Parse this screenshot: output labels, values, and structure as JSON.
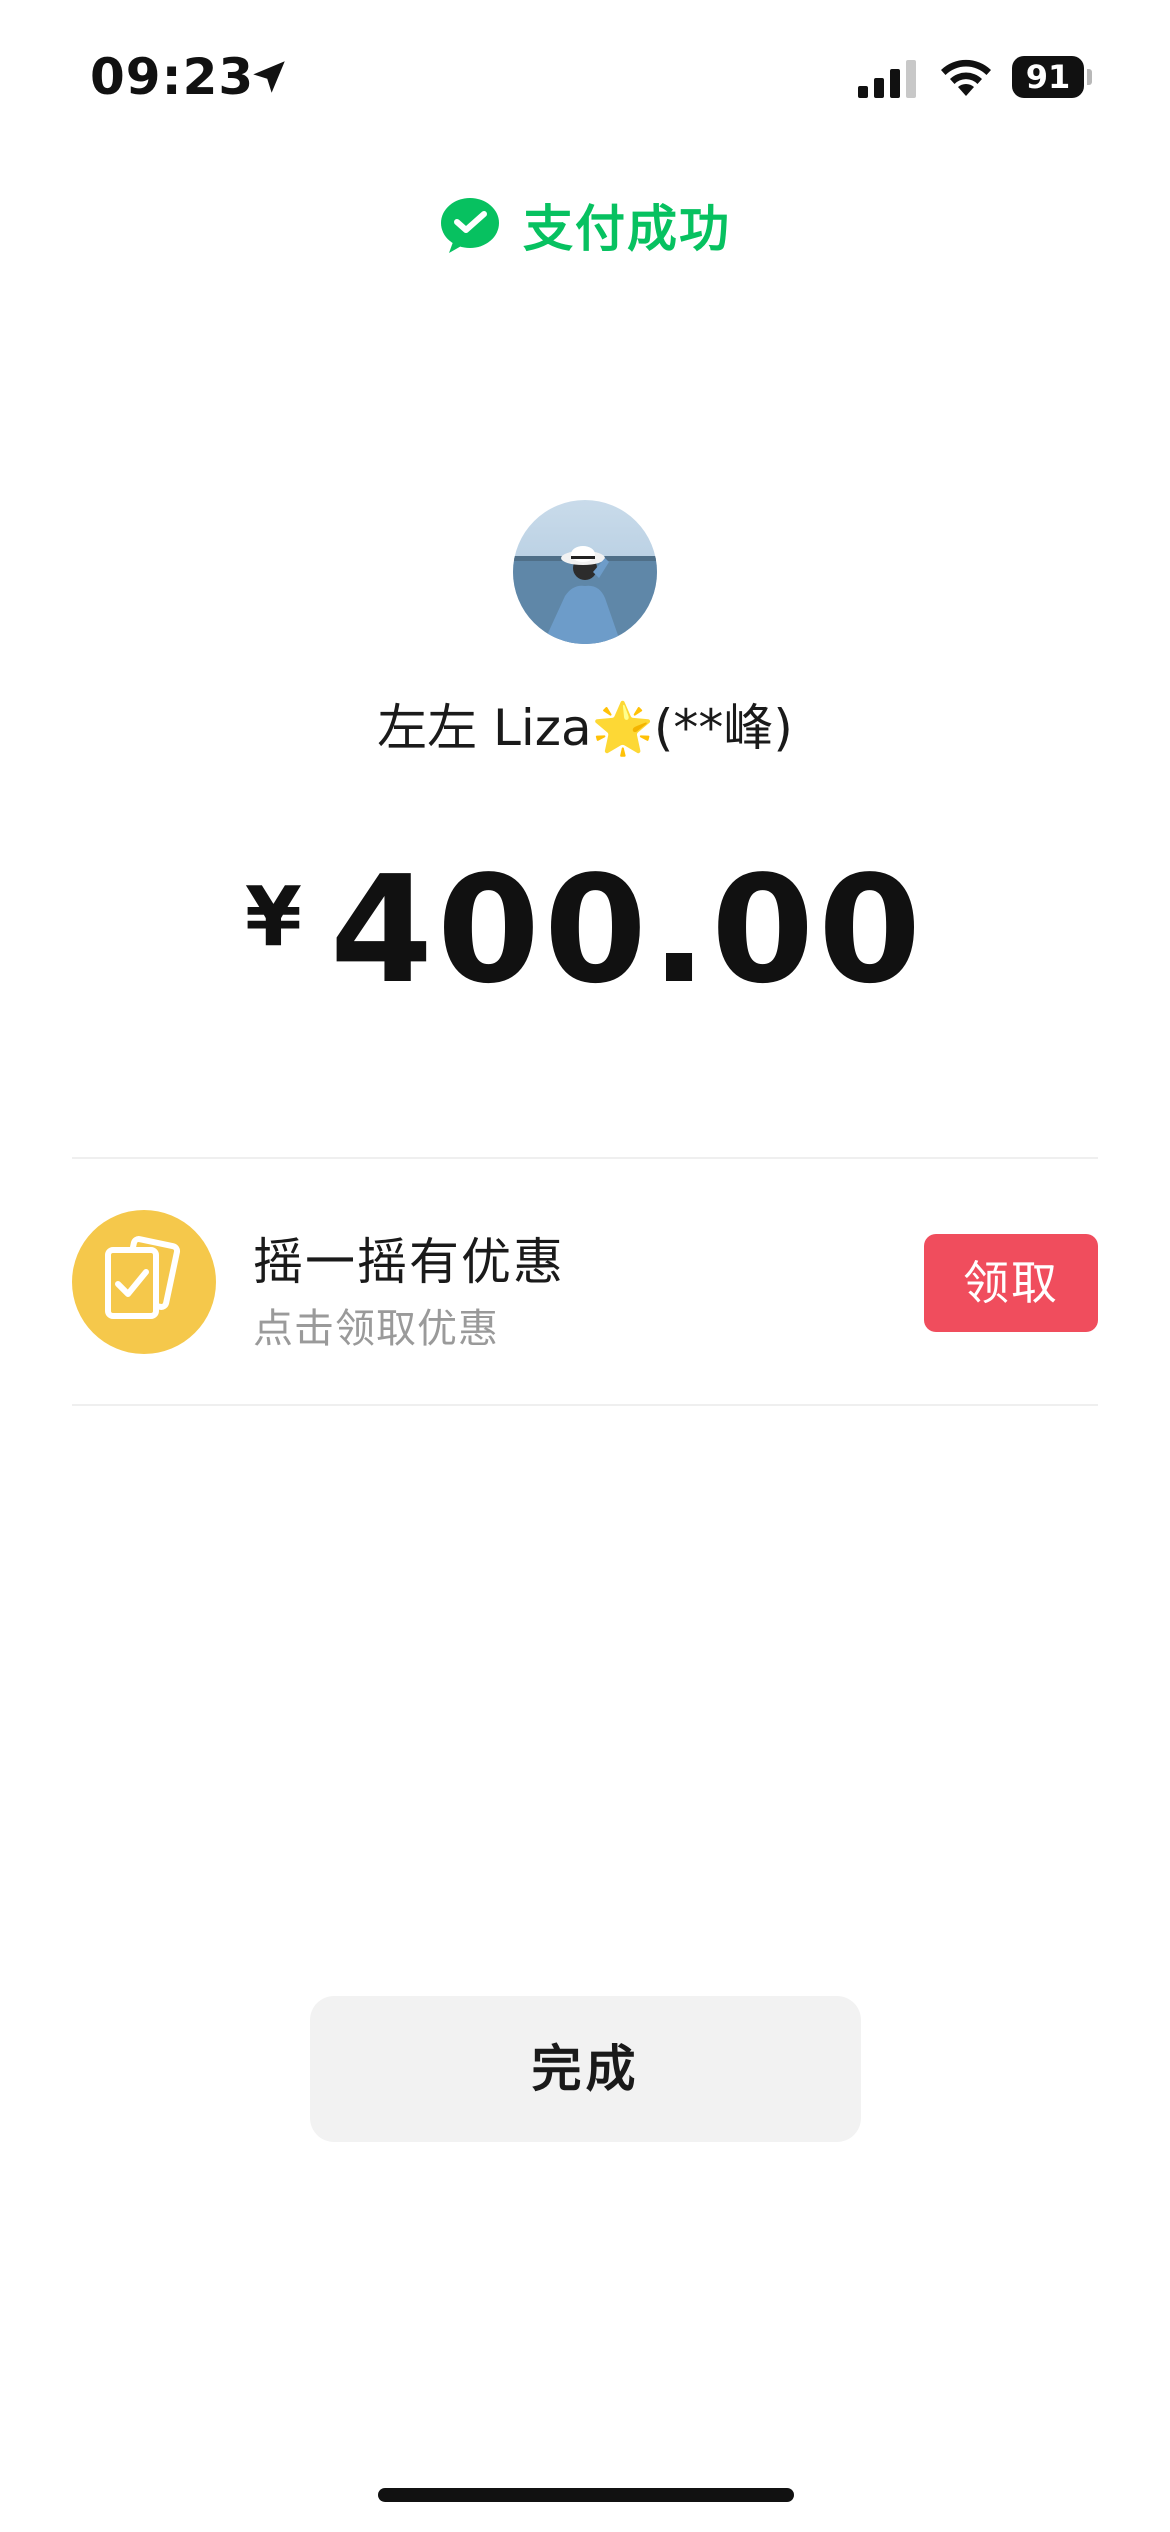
{
  "status_bar": {
    "time": "09:23",
    "battery_level": "91",
    "signal_bars_filled": 3,
    "signal_bars_total": 4,
    "location_icon": "location-arrow-icon",
    "wifi_icon": "wifi-icon"
  },
  "header": {
    "icon": "wechat-pay-icon",
    "title": "支付成功",
    "color": "#07c160"
  },
  "payee": {
    "avatar": "avatar",
    "name": "左左 Liza🌟(**峰)"
  },
  "payment": {
    "currency_symbol": "¥",
    "amount": "400.00"
  },
  "promo": {
    "icon": "coupon-cards-icon",
    "title": "摇一摇有优惠",
    "subtitle": "点击领取优惠",
    "button_label": "领取",
    "icon_color": "#f5c84b",
    "button_color": "#f04d5d"
  },
  "footer": {
    "done_label": "完成"
  }
}
